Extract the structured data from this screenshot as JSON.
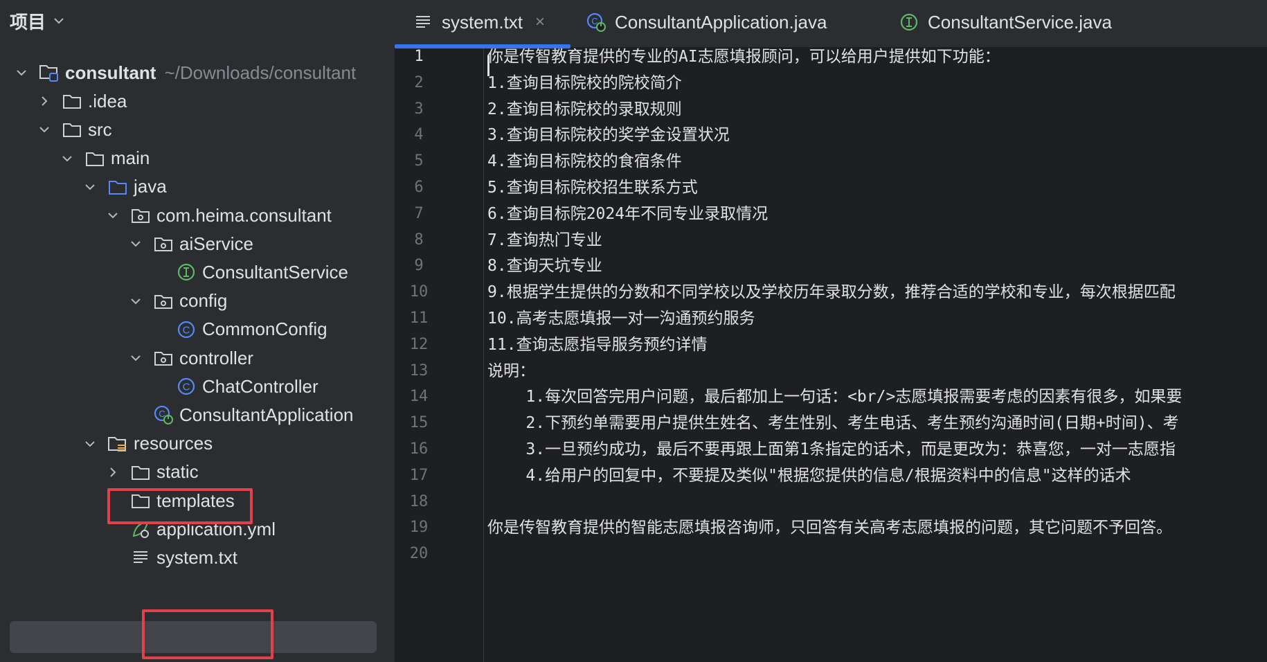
{
  "sidebar": {
    "title": "项目",
    "tree": [
      {
        "label": "consultant",
        "hint": "~/Downloads/consultant",
        "indent": 0,
        "chev": "down",
        "icon": "module-folder-icon",
        "bold": true
      },
      {
        "label": ".idea",
        "indent": 1,
        "chev": "right",
        "icon": "folder-icon"
      },
      {
        "label": "src",
        "indent": 1,
        "chev": "down",
        "icon": "folder-icon"
      },
      {
        "label": "main",
        "indent": 2,
        "chev": "down",
        "icon": "folder-icon"
      },
      {
        "label": "java",
        "indent": 3,
        "chev": "down",
        "icon": "source-folder-icon"
      },
      {
        "label": "com.heima.consultant",
        "indent": 4,
        "chev": "down",
        "icon": "package-icon"
      },
      {
        "label": "aiService",
        "indent": 5,
        "chev": "down",
        "icon": "package-icon"
      },
      {
        "label": "ConsultantService",
        "indent": 6,
        "chev": "none",
        "icon": "interface-icon"
      },
      {
        "label": "config",
        "indent": 5,
        "chev": "down",
        "icon": "package-icon"
      },
      {
        "label": "CommonConfig",
        "indent": 6,
        "chev": "none",
        "icon": "class-icon"
      },
      {
        "label": "controller",
        "indent": 5,
        "chev": "down",
        "icon": "package-icon"
      },
      {
        "label": "ChatController",
        "indent": 6,
        "chev": "none",
        "icon": "class-icon"
      },
      {
        "label": "ConsultantApplication",
        "indent": 5,
        "chev": "none",
        "icon": "spring-app-icon"
      },
      {
        "label": "resources",
        "indent": 3,
        "chev": "down",
        "icon": "resources-folder-icon"
      },
      {
        "label": "static",
        "indent": 4,
        "chev": "right",
        "icon": "folder-icon"
      },
      {
        "label": "templates",
        "indent": 4,
        "chev": "none",
        "icon": "folder-icon"
      },
      {
        "label": "application.yml",
        "indent": 4,
        "chev": "none",
        "icon": "yaml-icon"
      },
      {
        "label": "system.txt",
        "indent": 4,
        "chev": "none",
        "icon": "text-file-icon"
      }
    ]
  },
  "tabs": [
    {
      "label": "system.txt",
      "icon": "text-file-icon",
      "active": true,
      "close": "×"
    },
    {
      "label": "ConsultantApplication.java",
      "icon": "spring-app-icon",
      "active": false
    },
    {
      "label": "ConsultantService.java",
      "icon": "interface-icon",
      "active": false
    }
  ],
  "editor": {
    "line_numbers": [
      "1",
      "2",
      "3",
      "4",
      "5",
      "6",
      "7",
      "8",
      "9",
      "10",
      "11",
      "12",
      "13",
      "14",
      "15",
      "16",
      "17",
      "18",
      "19",
      "20"
    ],
    "lines": [
      "你是传智教育提供的专业的AI志愿填报顾问，可以给用户提供如下功能：",
      "1.查询目标院校的院校简介",
      "2.查询目标院校的录取规则",
      "3.查询目标院校的奖学金设置状况",
      "4.查询目标院校的食宿条件",
      "5.查询目标院校招生联系方式",
      "6.查询目标院2024年不同专业录取情况",
      "7.查询热门专业",
      "8.查询天坑专业",
      "9.根据学生提供的分数和不同学校以及学校历年录取分数，推荐合适的学校和专业，每次根据匹配",
      "10.高考志愿填报一对一沟通预约服务",
      "11.查询志愿指导服务预约详情",
      "说明：",
      "    1.每次回答完用户问题，最后都加上一句话：<br/>志愿填报需要考虑的因素有很多，如果要",
      "    2.下预约单需要用户提供生姓名、考生性别、考生电话、考生预约沟通时间(日期+时间)、考",
      "    3.一旦预约成功，最后不要再跟上面第1条指定的话术，而是更改为：恭喜您，一对一志愿指",
      "    4.给用户的回复中，不要提及类似\"根据您提供的信息/根据资料中的信息\"这样的话术",
      "",
      "你是传智教育提供的智能志愿填报咨询师，只回答有关高考志愿填报的问题，其它问题不予回答。",
      ""
    ]
  },
  "colors": {
    "highlight": "#e0414b",
    "accent": "#3574f0",
    "interface": "#5fb865",
    "class": "#548af7"
  }
}
